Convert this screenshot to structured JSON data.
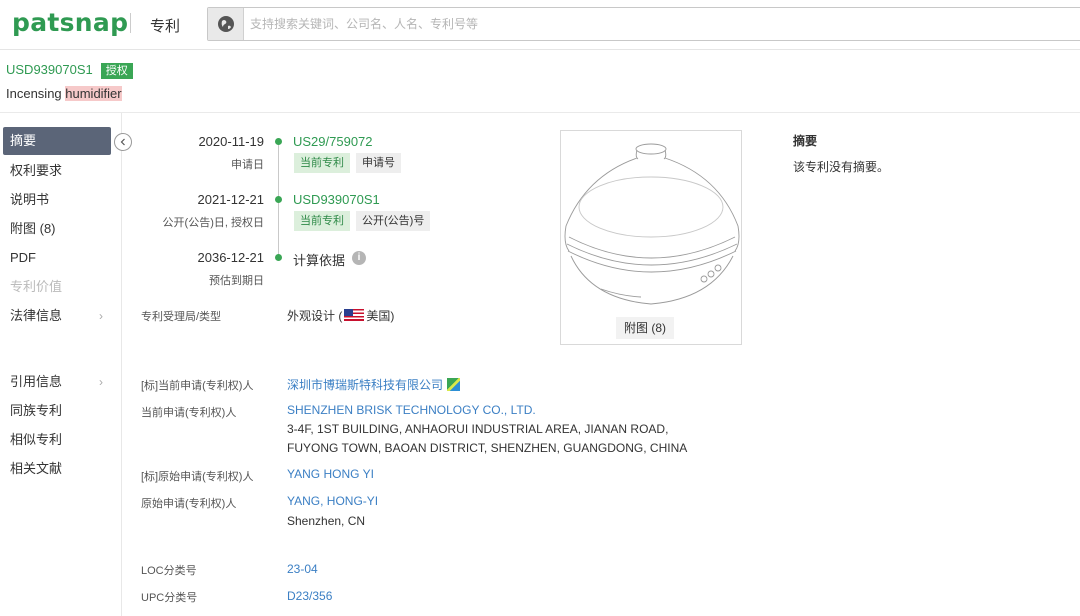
{
  "topbar": {
    "logo": "patsnap",
    "module": "专利",
    "search_placeholder": "支持搜索关键词、公司名、人名、专利号等"
  },
  "patent": {
    "number": "USD939070S1",
    "status_badge": "授权",
    "title_prefix": "Incensing ",
    "title_highlight": "humidifier"
  },
  "sidebar": {
    "items": [
      {
        "label": "摘要"
      },
      {
        "label": "权利要求"
      },
      {
        "label": "说明书"
      },
      {
        "label": "附图 (8)"
      },
      {
        "label": "PDF"
      },
      {
        "label": "专利价值"
      },
      {
        "label": "法律信息"
      },
      {
        "label": "引用信息"
      },
      {
        "label": "同族专利"
      },
      {
        "label": "相似专利"
      },
      {
        "label": "相关文献"
      }
    ]
  },
  "timeline": [
    {
      "date": "2020-11-19",
      "sub": "申请日",
      "value": "US29/759072",
      "tags": [
        "当前专利",
        "申请号"
      ]
    },
    {
      "date": "2021-12-21",
      "sub": "公开(公告)日, 授权日",
      "value": "USD939070S1",
      "tags": [
        "当前专利",
        "公开(公告)号"
      ]
    },
    {
      "date": "2036-12-21",
      "sub": "预估到期日",
      "value": "计算依据"
    }
  ],
  "fields": {
    "office_label": "专利受理局/类型",
    "office_type": "外观设计 (",
    "office_country": "美国)",
    "std_assignee_label": "[标]当前申请(专利权)人",
    "std_assignee": "深圳市博瑞斯特科技有限公司",
    "assignee_label": "当前申请(专利权)人",
    "assignee_name": "SHENZHEN BRISK TECHNOLOGY CO., LTD.",
    "assignee_addr1": "3-4F, 1ST BUILDING, ANHAORUI INDUSTRIAL AREA, JIANAN ROAD,",
    "assignee_addr2": "FUYONG TOWN, BAOAN DISTRICT, SHENZHEN, GUANGDONG, CHINA",
    "std_orig_label": "[标]原始申请(专利权)人",
    "std_orig": "YANG HONG YI",
    "orig_label": "原始申请(专利权)人",
    "orig_name": "YANG, HONG-YI",
    "orig_loc": "Shenzhen, CN",
    "loc_label": "LOC分类号",
    "loc_value": "23-04",
    "upc_label": "UPC分类号",
    "upc_value": "D23/356"
  },
  "drawing": {
    "button": "附图 (8)"
  },
  "abstract": {
    "title": "摘要",
    "text": "该专利没有摘要。"
  },
  "colors": {
    "brand": "#2f9a52",
    "link": "#3b7fc4",
    "nav_active": "#5b6578"
  }
}
